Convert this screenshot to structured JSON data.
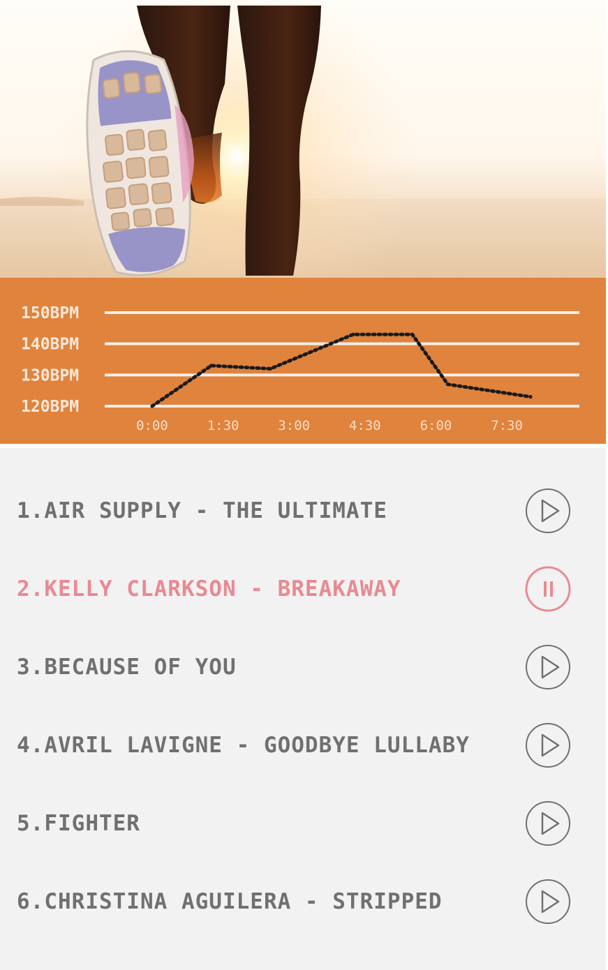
{
  "chart": {
    "background_color": "#e0833d",
    "line_color": "#1a1a1a"
  },
  "chart_data": {
    "type": "line",
    "title": "",
    "xlabel": "",
    "ylabel": "",
    "x_ticks": [
      "0:00",
      "1:30",
      "3:00",
      "4:30",
      "6:00",
      "7:30"
    ],
    "y_ticks": [
      "120BPM",
      "130BPM",
      "140BPM",
      "150BPM"
    ],
    "ylim": [
      120,
      150
    ],
    "xlim": [
      "0:00",
      "8:00"
    ],
    "grid": true,
    "series": [
      {
        "points": [
          {
            "x": "0:00",
            "y": 120
          },
          {
            "x": "1:15",
            "y": 133
          },
          {
            "x": "2:30",
            "y": 132
          },
          {
            "x": "4:15",
            "y": 143
          },
          {
            "x": "5:30",
            "y": 143
          },
          {
            "x": "6:15",
            "y": 127
          },
          {
            "x": "8:00",
            "y": 123
          }
        ]
      }
    ]
  },
  "playlist": {
    "active_color": "#e88a92",
    "tracks": [
      {
        "title": "1.AIR SUPPLY - THE ULTIMATE",
        "state": "play",
        "icon": "play-circle-icon"
      },
      {
        "title": "2.KELLY CLARKSON - BREAKAWAY",
        "state": "playing",
        "icon": "pause-circle-icon"
      },
      {
        "title": "3.BECAUSE OF YOU",
        "state": "play",
        "icon": "play-circle-icon"
      },
      {
        "title": "4.AVRIL LAVIGNE - GOODBYE LULLABY",
        "state": "play",
        "icon": "play-circle-icon"
      },
      {
        "title": "5.FIGHTER",
        "state": "play",
        "icon": "play-circle-icon"
      },
      {
        "title": "6.CHRISTINA AGUILERA - STRIPPED",
        "state": "play",
        "icon": "play-circle-icon"
      }
    ]
  }
}
